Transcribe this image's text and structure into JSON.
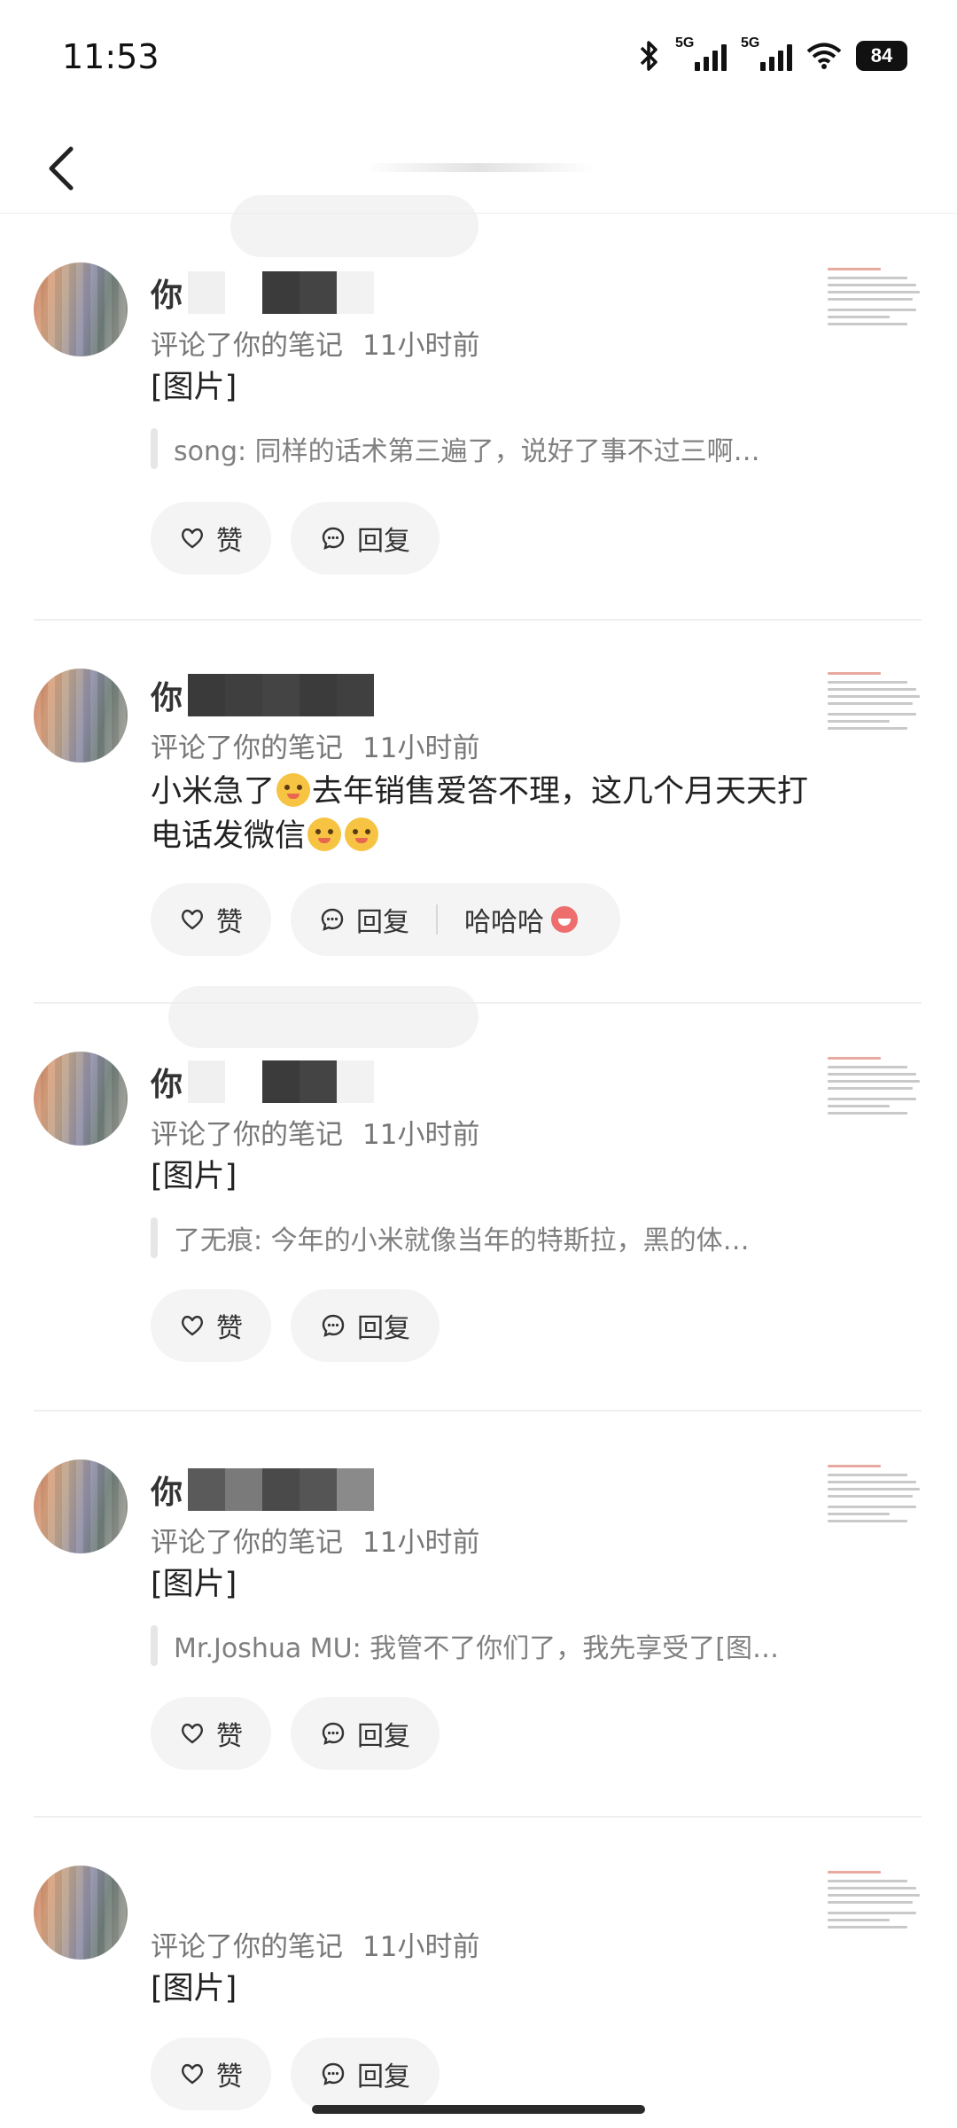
{
  "status_bar": {
    "time": "11:53",
    "battery": "84",
    "signal_label_1": "5G",
    "signal_label_2": "5G",
    "icons": [
      "bluetooth-icon",
      "signal-icon",
      "signal-icon",
      "wifi-icon",
      "battery-icon"
    ]
  },
  "nav": {
    "back_icon": "chevron-left-icon"
  },
  "notifications": [
    {
      "name_prefix": "你",
      "action": "评论了你的笔记",
      "time": "11小时前",
      "content": "[图片]",
      "quote": "song: 同样的话术第三遍了，说好了事不过三啊…",
      "like_label": "赞",
      "reply_label": "回复"
    },
    {
      "name_prefix": "你",
      "action": "评论了你的笔记",
      "time": "11小时前",
      "content_part1": "小米急了",
      "content_part2": "去年销售爱答不理，这几个月天天打电话发微信",
      "like_label": "赞",
      "reply_label": "回复",
      "extra_reply": "哈哈哈"
    },
    {
      "name_prefix": "你",
      "action": "评论了你的笔记",
      "time": "11小时前",
      "content": "[图片]",
      "quote": "了无痕: 今年的小米就像当年的特斯拉，黑的体…",
      "like_label": "赞",
      "reply_label": "回复"
    },
    {
      "name_prefix": "你",
      "action": "评论了你的笔记",
      "time": "11小时前",
      "content": "[图片]",
      "quote": "Mr.Joshua MU: 我管不了你们了，我先享受了[图…",
      "like_label": "赞",
      "reply_label": "回复"
    },
    {
      "name_prefix": "",
      "action": "评论了你的笔记",
      "time": "11小时前",
      "content": "[图片]",
      "like_label": "赞",
      "reply_label": "回复"
    }
  ]
}
